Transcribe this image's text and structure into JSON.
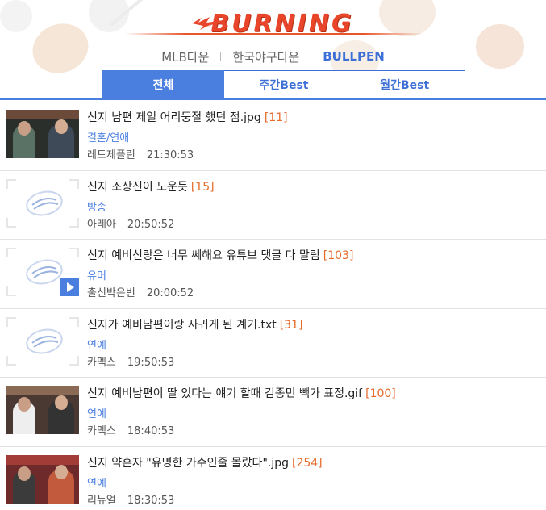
{
  "logo": {
    "text": "BURNING"
  },
  "site_nav": [
    {
      "label": "MLB타운",
      "active": false
    },
    {
      "label": "한국야구타운",
      "active": false
    },
    {
      "label": "BULLPEN",
      "active": true
    }
  ],
  "tabs": [
    {
      "label": "전체",
      "active": true
    },
    {
      "label": "주간Best",
      "active": false
    },
    {
      "label": "월간Best",
      "active": false
    }
  ],
  "posts": [
    {
      "title": "신지 남편 제일 어리둥절 했던 점.jpg",
      "comments": "[11]",
      "category": "결혼/연애",
      "author": "레드제플린",
      "time": "21:30:53",
      "thumb": "photo"
    },
    {
      "title": "신지 조상신이 도운듯",
      "comments": "[15]",
      "category": "방송",
      "author": "아레아",
      "time": "20:50:52",
      "thumb": "placeholder"
    },
    {
      "title": "신지 예비신랑은 너무 쎄해요 유튜브 댓글 다 말림",
      "comments": "[103]",
      "category": "유머",
      "author": "출신박은빈",
      "time": "20:00:52",
      "thumb": "placeholder-video"
    },
    {
      "title": "신지가 예비남편이랑 사귀게 된 계기.txt",
      "comments": "[31]",
      "category": "연예",
      "author": "카멕스",
      "time": "19:50:53",
      "thumb": "placeholder"
    },
    {
      "title": "신지 예비남편이 딸 있다는 얘기 할때 김종민 빽가 표정.gif",
      "comments": "[100]",
      "category": "연예",
      "author": "카멕스",
      "time": "18:40:53",
      "thumb": "photo-warm"
    },
    {
      "title": "신지 약혼자 \"유명한 가수인줄 몰랐다\".jpg",
      "comments": "[254]",
      "category": "연예",
      "author": "리뉴얼",
      "time": "18:30:53",
      "thumb": "photo-red"
    }
  ],
  "colors": {
    "accent": "#4a7fe0",
    "logo": "#e8452a",
    "count": "#e56a2a"
  }
}
